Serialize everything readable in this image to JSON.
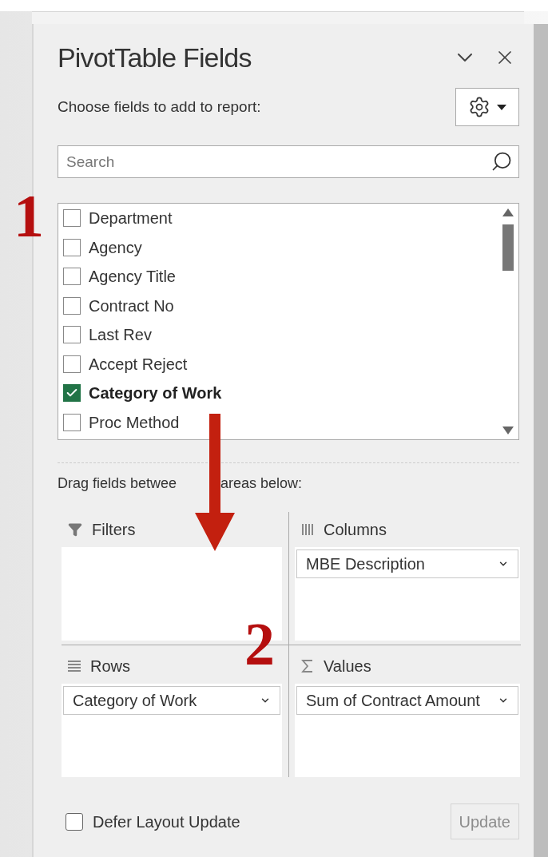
{
  "panel": {
    "title": "PivotTable Fields",
    "instruction": "Choose fields to add to report:",
    "search": {
      "placeholder": "Search"
    },
    "fields": [
      {
        "label": "Department",
        "checked": false
      },
      {
        "label": "Agency",
        "checked": false
      },
      {
        "label": "Agency Title",
        "checked": false
      },
      {
        "label": "Contract No",
        "checked": false
      },
      {
        "label": "Last Rev",
        "checked": false
      },
      {
        "label": "Accept Reject",
        "checked": false
      },
      {
        "label": "Category of Work",
        "checked": true
      },
      {
        "label": "Proc Method",
        "checked": false
      }
    ],
    "areas_hint": [
      "Drag fields betwee",
      "areas below:"
    ],
    "areas": [
      {
        "kind": "filters",
        "title": "Filters"
      },
      {
        "kind": "columns",
        "title": "Columns",
        "items": [
          {
            "label": "MBE Description"
          }
        ]
      },
      {
        "kind": "rows",
        "title": "Rows",
        "items": [
          {
            "label": "Category of Work"
          }
        ]
      },
      {
        "kind": "values",
        "title": "Values",
        "items": [
          {
            "label": "Sum of Contract Amount"
          }
        ]
      }
    ],
    "defer": {
      "label": "Defer Layout Update",
      "checked": false
    },
    "update_button": {
      "label": "Update",
      "disabled": true
    }
  },
  "annotations": [
    {
      "label": "1"
    },
    {
      "label": "2"
    }
  ]
}
